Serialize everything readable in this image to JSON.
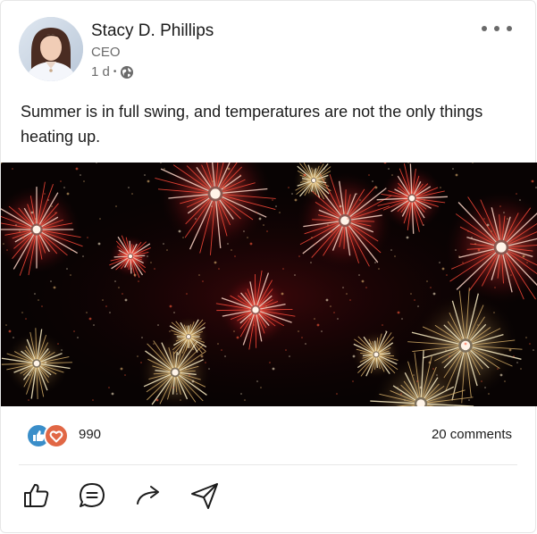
{
  "post": {
    "author_name": "Stacy D. Phillips",
    "author_title": "CEO",
    "timestamp": "1 d",
    "visibility_icon": "globe-icon",
    "text": "Summer is in full swing, and temperatures are not the only things heating up.",
    "media_description_icon": "fireworks-image"
  },
  "stats": {
    "reaction_count": "990",
    "comments_label": "20 comments",
    "reaction_icons": [
      "like-icon",
      "heart-icon"
    ]
  },
  "actions": [
    "like-icon",
    "comment-icon",
    "share-icon",
    "send-icon"
  ],
  "colors": {
    "like_reaction": "#3a8ec9",
    "love_reaction": "#e16745",
    "text": "#1b1b1b",
    "muted": "#6b6b6b"
  }
}
